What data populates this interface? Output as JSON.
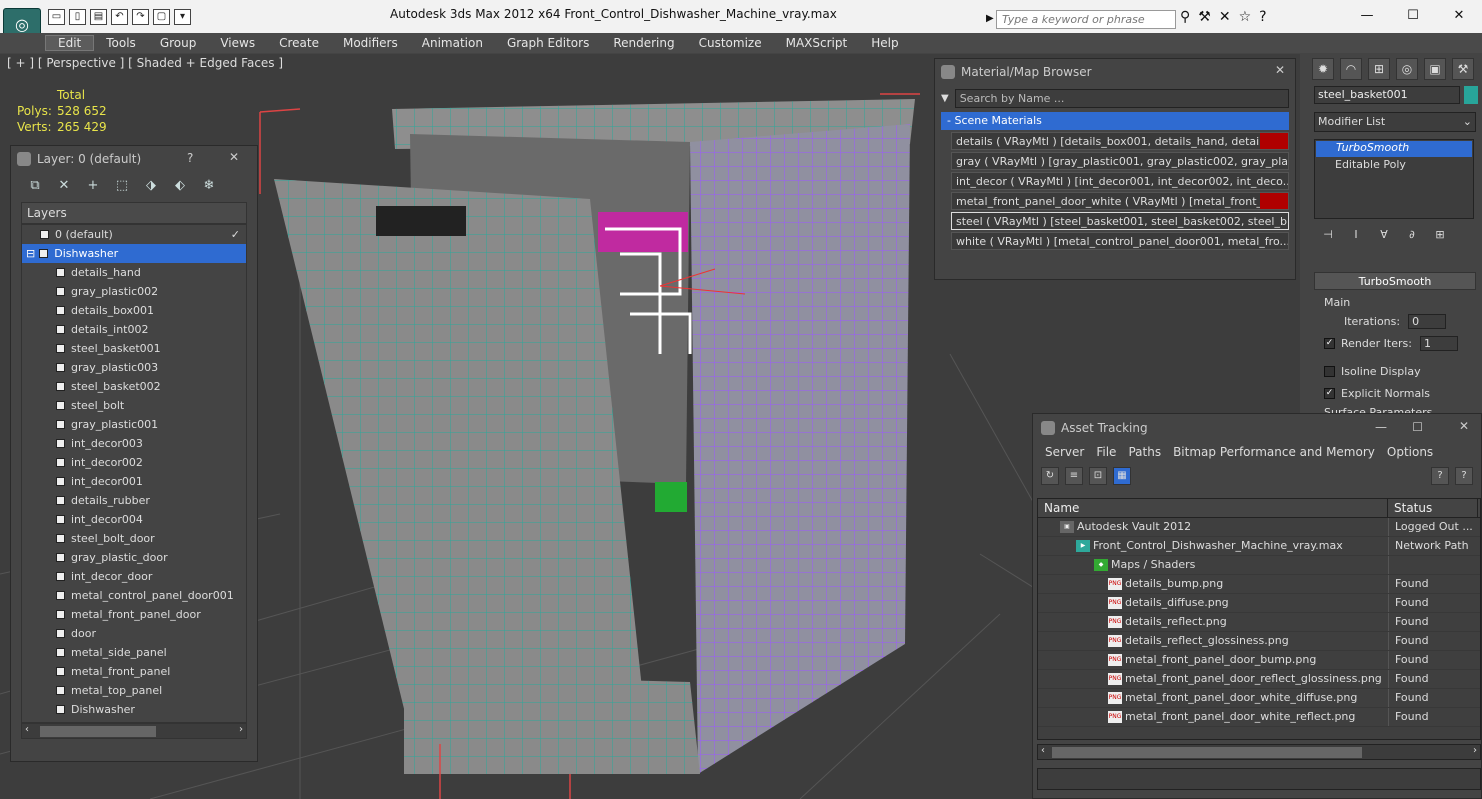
{
  "app": {
    "title": "Autodesk 3ds Max  2012 x64      Front_Control_Dishwasher_Machine_vray.max",
    "logo_text": "◎",
    "search_placeholder": "Type a keyword or phrase"
  },
  "menu": [
    "Edit",
    "Tools",
    "Group",
    "Views",
    "Create",
    "Modifiers",
    "Animation",
    "Graph Editors",
    "Rendering",
    "Customize",
    "MAXScript",
    "Help"
  ],
  "viewport": {
    "label": "[ + ] [ Perspective ] [ Shaded + Edged Faces ]",
    "stats": {
      "total_label": "Total",
      "polys_label": "Polys:",
      "polys": "528 652",
      "verts_label": "Verts:",
      "verts": "265 429"
    }
  },
  "layer_panel": {
    "title": "Layer: 0 (default)",
    "help": "?",
    "close": "✕",
    "header": "Layers",
    "layers": [
      "0 (default)",
      "Dishwasher"
    ],
    "items": [
      "details_hand",
      "gray_plastic002",
      "details_box001",
      "details_int002",
      "steel_basket001",
      "gray_plastic003",
      "steel_basket002",
      "steel_bolt",
      "gray_plastic001",
      "int_decor003",
      "int_decor002",
      "int_decor001",
      "details_rubber",
      "int_decor004",
      "steel_bolt_door",
      "gray_plastic_door",
      "int_decor_door",
      "metal_control_panel_door001",
      "metal_front_panel_door",
      "door",
      "metal_side_panel",
      "metal_front_panel",
      "metal_top_panel",
      "Dishwasher"
    ]
  },
  "material_browser": {
    "title": "Material/Map Browser",
    "search_placeholder": "Search by Name ...",
    "section": "- Scene Materials",
    "rows": [
      "details  ( VRayMtl ) [details_box001, details_hand, details_int...",
      "gray  ( VRayMtl ) [gray_plastic001, gray_plastic002, gray_pla...",
      "int_decor  ( VRayMtl ) [int_decor001, int_decor002, int_deco...",
      "metal_front_panel_door_white  ( VRayMtl ) [metal_front_pan...",
      "steel  ( VRayMtl ) [steel_basket001, steel_basket002, steel_b...",
      "white  ( VRayMtl ) [metal_control_panel_door001, metal_fro..."
    ]
  },
  "command_panel": {
    "object_name": "steel_basket001",
    "modifier_list": "Modifier List",
    "stack": [
      "TurboSmooth",
      "Editable Poly"
    ],
    "rollout": "TurboSmooth",
    "main_label": "Main",
    "iterations_label": "Iterations:",
    "iterations": "0",
    "render_iters_label": "Render Iters:",
    "render_iters": "1",
    "isoline_label": "Isoline Display",
    "explicit_label": "Explicit Normals",
    "surface_label": "Surface Parameters"
  },
  "asset_tracking": {
    "title": "Asset Tracking",
    "menu": [
      "Server",
      "File",
      "Paths",
      "Bitmap Performance and Memory",
      "Options"
    ],
    "columns": [
      "Name",
      "Status"
    ],
    "rows": [
      {
        "name": "Autodesk Vault 2012",
        "status": "Logged Out ..."
      },
      {
        "name": "Front_Control_Dishwasher_Machine_vray.max",
        "status": "Network Path"
      },
      {
        "name": "Maps / Shaders",
        "status": ""
      },
      {
        "name": "details_bump.png",
        "status": "Found"
      },
      {
        "name": "details_diffuse.png",
        "status": "Found"
      },
      {
        "name": "details_reflect.png",
        "status": "Found"
      },
      {
        "name": "details_reflect_glossiness.png",
        "status": "Found"
      },
      {
        "name": "metal_front_panel_door_bump.png",
        "status": "Found"
      },
      {
        "name": "metal_front_panel_door_reflect_glossiness.png",
        "status": "Found"
      },
      {
        "name": "metal_front_panel_door_white_diffuse.png",
        "status": "Found"
      },
      {
        "name": "metal_front_panel_door_white_reflect.png",
        "status": "Found"
      }
    ]
  },
  "colors": {
    "accent": "#2f6bd1",
    "wire_teal": "#2ea89b",
    "wire_purple": "#9b59ff",
    "stats_yellow": "#e8e44a"
  }
}
